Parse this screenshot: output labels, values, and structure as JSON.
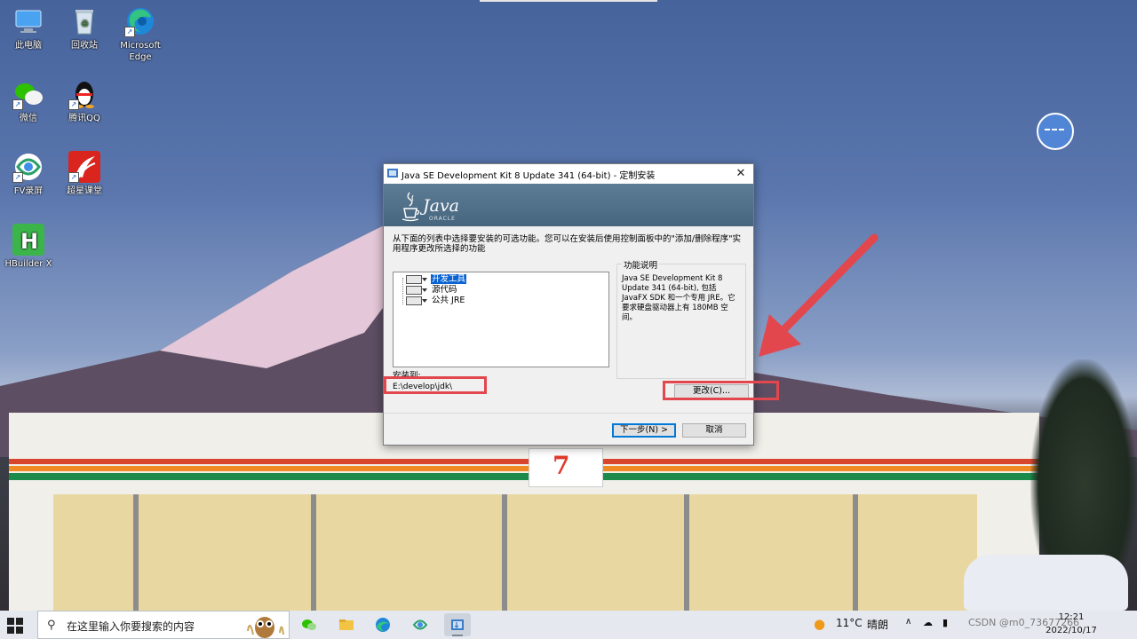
{
  "desktop": {
    "icons": [
      {
        "label": "此电脑"
      },
      {
        "label": "回收站"
      },
      {
        "label": "Microsoft Edge"
      },
      {
        "label": "微信"
      },
      {
        "label": "腾讯QQ"
      },
      {
        "label": "FV录屏"
      },
      {
        "label": "超星课堂"
      },
      {
        "label": "HBuilder X"
      }
    ],
    "store_sign": "7"
  },
  "dialog": {
    "title": "Java SE Development Kit 8 Update 341 (64-bit) - 定制安装",
    "close_glyph": "✕",
    "banner_logo": "Java",
    "banner_sub": "ORACLE",
    "description": "从下面的列表中选择要安装的可选功能。您可以在安装后使用控制面板中的\"添加/删除程序\"实用程序更改所选择的功能",
    "features": [
      {
        "label": "开发工具",
        "selected": true
      },
      {
        "label": "源代码",
        "selected": false
      },
      {
        "label": "公共 JRE",
        "selected": false
      }
    ],
    "feature_desc_title": "功能说明",
    "feature_desc_text": "Java SE Development Kit 8 Update 341 (64-bit), 包括 JavaFX SDK 和一个专用 JRE。它要求硬盘驱动器上有 180MB 空间。",
    "install_to_label": "安装到:",
    "install_path": "E:\\develop\\jdk\\",
    "change_button": "更改(C)...",
    "next_button": "下一步(N) >",
    "cancel_button": "取消"
  },
  "annotation_color": "#e2474e",
  "taskbar": {
    "search_placeholder": "在这里输入你要搜索的内容",
    "weather_temp": "11°C",
    "weather_text": "晴朗",
    "time": "12:21",
    "date": "2022/10/17",
    "tray_text": "CSDN @m0_73677266"
  }
}
